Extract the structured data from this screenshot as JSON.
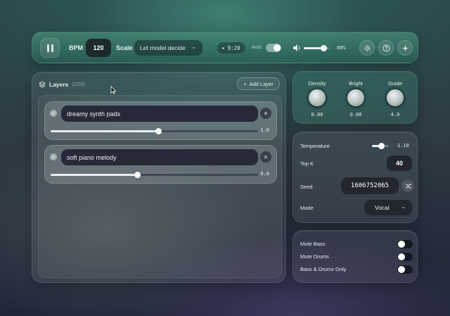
{
  "topbar": {
    "bpm_label": "BPM",
    "bpm_value": "120",
    "scale_label": "Scale",
    "scale_value": "Let model decide",
    "time": "9:20",
    "auto_label": "Auto",
    "auto_on": true,
    "volume_percent": 80,
    "volume_label": "80%",
    "icons": [
      "pause-icon",
      "chevron-down-icon",
      "volume-icon",
      "gear-icon",
      "help-icon",
      "sparkle-icon"
    ]
  },
  "layers": {
    "title": "Layers",
    "count": "(2/50)",
    "add_label": "Add Layer",
    "items": [
      {
        "prompt": "dreamy synth pads",
        "weight": 1.0,
        "weight_label": "1.0",
        "enabled": true
      },
      {
        "prompt": "soft piano melody",
        "weight": 0.8,
        "weight_label": "0.8",
        "enabled": true
      }
    ]
  },
  "knobs": [
    {
      "label": "Density",
      "value": "0.00"
    },
    {
      "label": "Bright",
      "value": "0.00"
    },
    {
      "label": "Guide",
      "value": "4.0"
    }
  ],
  "params": {
    "temperature_label": "Temperature",
    "temperature_value": "1.10",
    "temperature_fraction": 0.55,
    "topk_label": "Top K",
    "topk_value": "40",
    "seed_label": "Seed",
    "seed_value": "1606752065",
    "mode_label": "Mode",
    "mode_value": "Vocal"
  },
  "toggles": [
    {
      "label": "Mute Bass",
      "on": false
    },
    {
      "label": "Mute Drums",
      "on": false
    },
    {
      "label": "Bass & Drums Only",
      "on": false
    }
  ],
  "colors": {
    "accent_teal": "#3e7d72",
    "dark_field": "#23262f",
    "layer_input": "#272939"
  }
}
